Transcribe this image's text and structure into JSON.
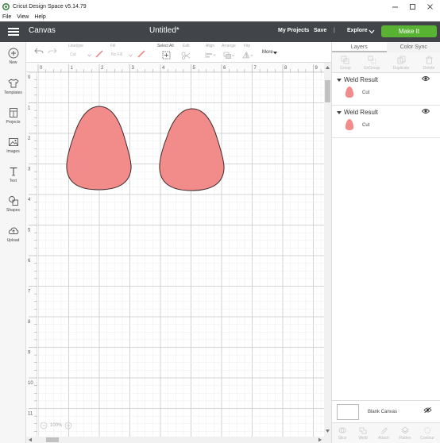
{
  "window": {
    "title": "Cricut Design Space  v5.14.79",
    "controls": [
      "minimize-icon",
      "maximize-icon",
      "close-icon"
    ]
  },
  "menu": [
    "File",
    "View",
    "Help"
  ],
  "header": {
    "section": "Canvas",
    "project_title": "Untitled*",
    "my_projects": "My Projects",
    "save": "Save",
    "separator": "|",
    "explore": "Explore",
    "make_it": "Make It",
    "make_it_color": "#57b331",
    "bar_color": "#414549"
  },
  "sidebar": {
    "items": [
      {
        "label": "New",
        "icon": "plus-icon"
      },
      {
        "label": "Templates",
        "icon": "shirt-icon"
      },
      {
        "label": "Projects",
        "icon": "projects-icon"
      },
      {
        "label": "Images",
        "icon": "image-icon"
      },
      {
        "label": "Text",
        "icon": "text-icon"
      },
      {
        "label": "Shapes",
        "icon": "shapes-icon"
      },
      {
        "label": "Upload",
        "icon": "cloud-upload-icon"
      }
    ]
  },
  "toolbar": {
    "operation_label": "Linetype",
    "operation_value": "Cut",
    "fill_label": "Fill",
    "fill_value": "No Fill",
    "select_all": "Select All",
    "edit": "Edit",
    "align": "Align",
    "arrange": "Arrange",
    "flip": "Flip",
    "more": "More"
  },
  "canvas": {
    "ruler_top": [
      "0",
      "1",
      "2",
      "3",
      "4",
      "5",
      "6",
      "7",
      "8",
      "9"
    ],
    "ruler_left": [
      "0",
      "1",
      "2",
      "3",
      "4",
      "5",
      "6",
      "7",
      "8",
      "9",
      "10",
      "11"
    ],
    "zoom": "100%",
    "shape_fill": "#f28c8a",
    "shape_stroke": "#3a2a2a"
  },
  "right_panel": {
    "tabs": [
      "Layers",
      "Color Sync"
    ],
    "actions_top": [
      "Group",
      "UnGroup",
      "Duplicate",
      "Delete"
    ],
    "layers": [
      {
        "name": "Weld Result",
        "operation": "Cut"
      },
      {
        "name": "Weld Result",
        "operation": "Cut"
      }
    ],
    "blank_canvas": "Blank Canvas",
    "actions_bottom": [
      "Slice",
      "Weld",
      "Attach",
      "Flatten",
      "Contour"
    ]
  }
}
